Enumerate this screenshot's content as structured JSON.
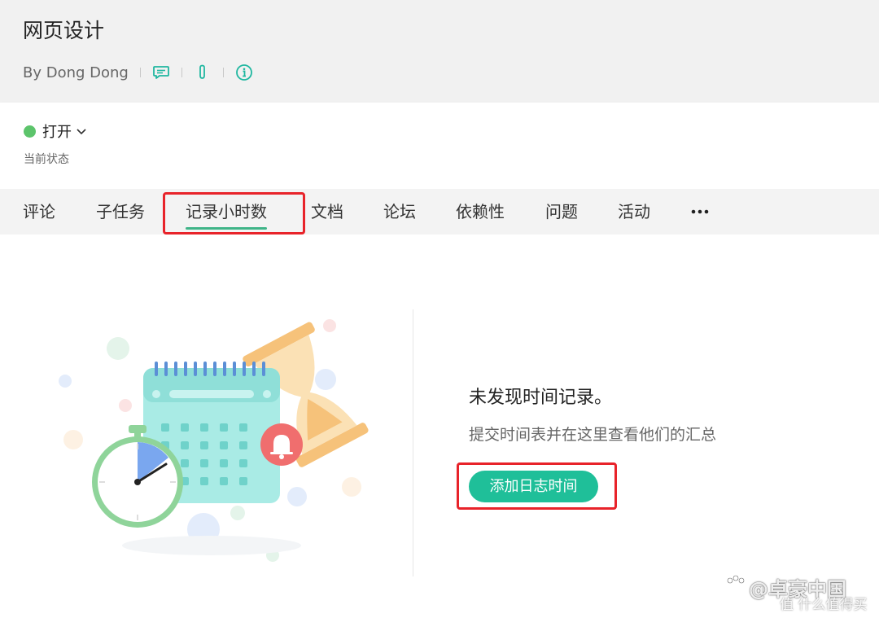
{
  "header": {
    "title": "网页设计",
    "author": "By Dong Dong",
    "icons": [
      "comment-icon",
      "attachment-icon",
      "info-icon"
    ]
  },
  "status": {
    "value": "打开",
    "label": "当前状态",
    "dot_color": "#5cc46b"
  },
  "tabs": [
    {
      "label": "评论"
    },
    {
      "label": "子任务"
    },
    {
      "label": "记录小时数",
      "active": true
    },
    {
      "label": "文档"
    },
    {
      "label": "论坛"
    },
    {
      "label": "依赖性"
    },
    {
      "label": "问题"
    },
    {
      "label": "活动"
    }
  ],
  "more_icon": "more-horizontal-icon",
  "empty_state": {
    "title": "未发现时间记录。",
    "description": "提交时间表并在这里查看他们的汇总",
    "button_label": "添加日志时间"
  },
  "watermark": {
    "main": "@卓豪中国",
    "sub": "值 什么值得买"
  },
  "colors": {
    "accent": "#1fbf99",
    "tab_underline": "#3fb488",
    "annotation": "#e8232a"
  }
}
